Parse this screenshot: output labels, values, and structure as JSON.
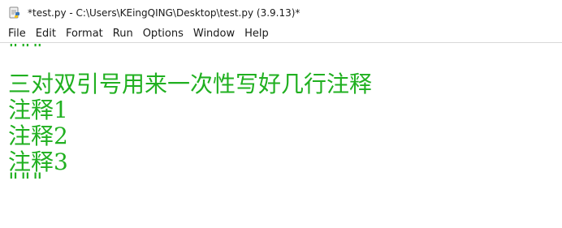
{
  "window": {
    "title": "*test.py - C:\\Users\\KEingQING\\Desktop\\test.py (3.9.13)*"
  },
  "menu": {
    "items": [
      "File",
      "Edit",
      "Format",
      "Run",
      "Options",
      "Window",
      "Help"
    ]
  },
  "editor": {
    "lines": [
      "\"\"\"",
      "三对双引号用来一次性写好几行注释",
      "注释1",
      "注释2",
      "注释3",
      "\"\"\""
    ],
    "text_color": "#20b020"
  },
  "icons": {
    "app": "python-idle-icon"
  }
}
